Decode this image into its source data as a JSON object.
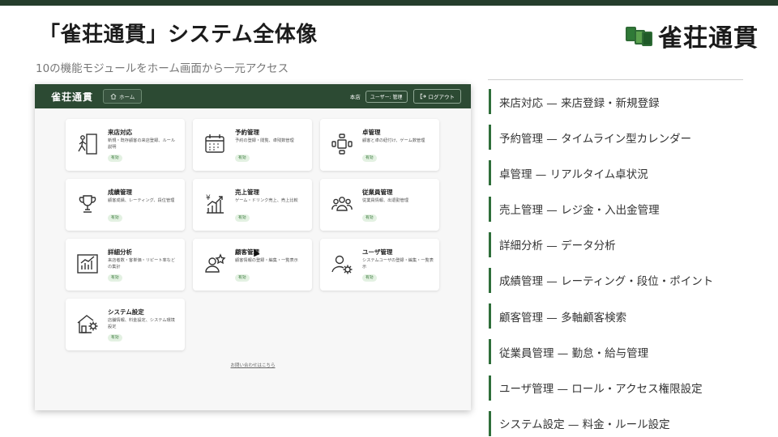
{
  "slide": {
    "title": "「雀荘通貫」システム全体像",
    "subtitle": "10の機能モジュールをホーム画面から一元アクセス",
    "brand": "雀荘通貫",
    "colors": {
      "accent": "#2f6e3a",
      "header": "#2c4a33",
      "badge_bg": "#e3f1e2"
    }
  },
  "app": {
    "logo": "雀荘通貫",
    "home_label": "ホーム",
    "store_label": "本店",
    "user_label": "ユーザー: 管理",
    "logout_label": "ログアウト",
    "inquiry_link": "お問い合わせはこちら",
    "cards": [
      {
        "title": "来店対応",
        "desc": "新規・既存顧客の来店登録、ルール説明",
        "badge": "有効",
        "icon": "walk-in-icon"
      },
      {
        "title": "予約管理",
        "desc": "予約の登録・閲覧、卓残数管理",
        "badge": "有効",
        "icon": "calendar-icon"
      },
      {
        "title": "卓管理",
        "desc": "顧客と卓の紐付け、ゲーム数管理",
        "badge": "有効",
        "icon": "table-seats-icon"
      },
      {
        "title": "成績管理",
        "desc": "顧客成績、レーティング、段位管理",
        "badge": "有効",
        "icon": "trophy-icon"
      },
      {
        "title": "売上管理",
        "desc": "ゲーム・ドリンク売上、売上比較",
        "badge": "有効",
        "icon": "sales-chart-icon"
      },
      {
        "title": "従業員管理",
        "desc": "従業員情報、出退勤管理",
        "badge": "有効",
        "icon": "staff-group-icon"
      },
      {
        "title": "詳細分析",
        "desc": "来店者数・客単価・リピート率などの集計",
        "badge": "有効",
        "icon": "analytics-icon"
      },
      {
        "title": "顧客管理",
        "desc": "顧客情報の登録・編集・一覧表示",
        "badge": "有効",
        "icon": "customer-star-icon"
      },
      {
        "title": "ユーザ管理",
        "desc": "システムユーザの登録・編集・一覧表示",
        "badge": "有効",
        "icon": "user-gear-icon"
      },
      {
        "title": "システム設定",
        "desc": "店舗情報、料金設定、システム環境設定",
        "badge": "有効",
        "icon": "house-gear-icon"
      }
    ]
  },
  "modules": [
    "来店対応 — 来店登録・新規登録",
    "予約管理 — タイムライン型カレンダー",
    "卓管理 — リアルタイム卓状況",
    "売上管理 — レジ金・入出金管理",
    "詳細分析 — データ分析",
    "成績管理 — レーティング・段位・ポイント",
    "顧客管理 — 多軸顧客検索",
    "従業員管理 — 勤怠・給与管理",
    "ユーザ管理 — ロール・アクセス権限設定",
    "システム設定 — 料金・ルール設定"
  ]
}
